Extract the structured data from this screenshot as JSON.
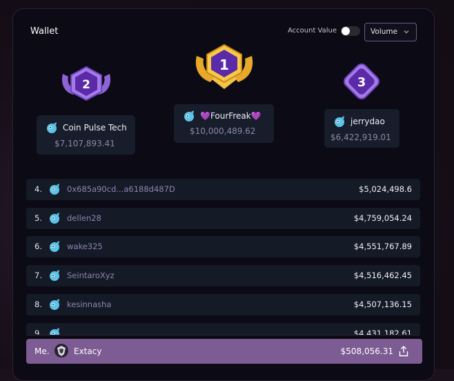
{
  "header": {
    "title": "Wallet",
    "account_value_label": "Account Value",
    "account_value_on": false,
    "sort_select": "Volume"
  },
  "podium": [
    {
      "rank": "1",
      "name": "FourFreak",
      "name_prefix": "💜",
      "name_suffix": "💜",
      "value": "$10,000,489.62"
    },
    {
      "rank": "2",
      "name": "Coin Pulse Tech",
      "value": "$7,107,893.41"
    },
    {
      "rank": "3",
      "name": "jerrydao",
      "value": "$6,422,919.01"
    }
  ],
  "rows": [
    {
      "rank": "4.",
      "name": "0x685a90cd...a6188d487D",
      "value": "$5,024,498.6"
    },
    {
      "rank": "5.",
      "name": "dellen28",
      "value": "$4,759,054.24"
    },
    {
      "rank": "6.",
      "name": "wake325",
      "value": "$4,551,767.89"
    },
    {
      "rank": "7.",
      "name": "SeintaroXyz",
      "value": "$4,516,462.45"
    },
    {
      "rank": "8.",
      "name": "kesinnasha",
      "value": "$4,507,136.15"
    },
    {
      "rank": "9.",
      "name": "...",
      "value": "$4,431,182.61"
    }
  ],
  "me": {
    "label": "Me.",
    "name": "Extacy",
    "value": "$508,056.31"
  },
  "colors": {
    "accent": "#7d5c93",
    "gold": "#f1b73a",
    "purple_medal": "#7b4fd0",
    "avatar_blue": "#5cc4e8"
  }
}
